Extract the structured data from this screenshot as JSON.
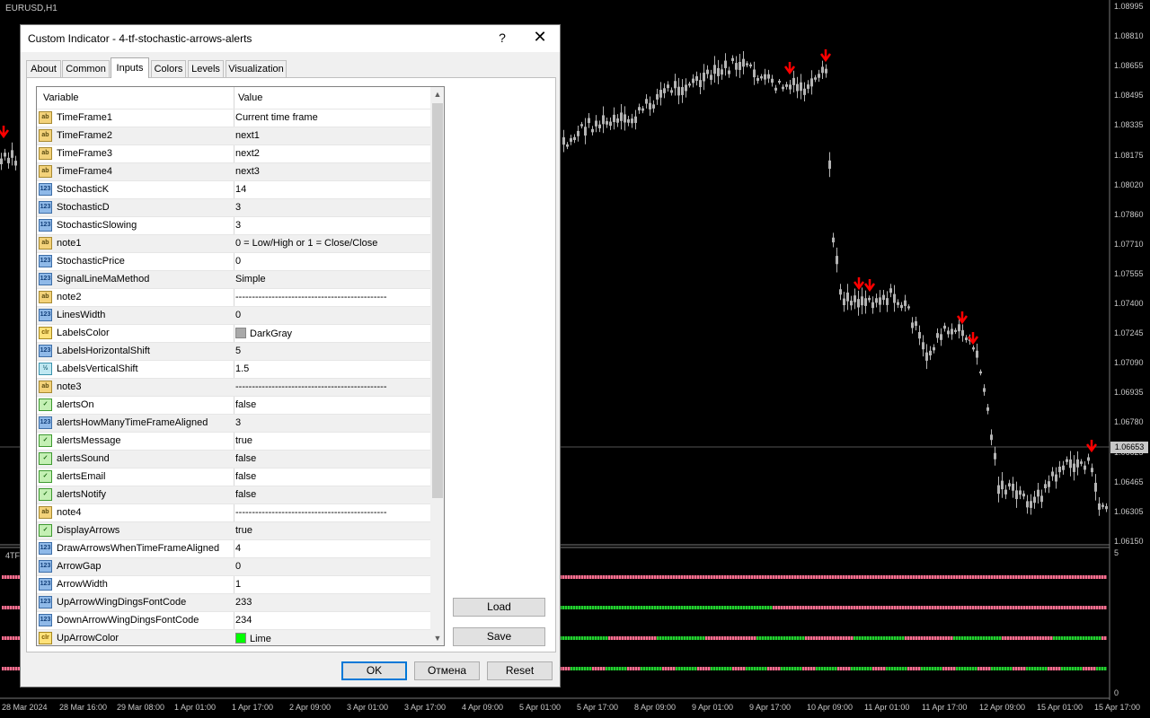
{
  "chart": {
    "symbol_label": "EURUSD,H1",
    "current_price": "1.06653",
    "price_axis": [
      "1.08995",
      "1.08810",
      "1.08655",
      "1.08495",
      "1.08335",
      "1.08175",
      "1.08020",
      "1.07860",
      "1.07710",
      "1.07555",
      "1.07400",
      "1.07245",
      "1.07090",
      "1.06935",
      "1.06780",
      "1.06625",
      "1.06465",
      "1.06305",
      "1.06150"
    ],
    "time_axis": [
      "28 Mar 2024",
      "28 Mar 16:00",
      "29 Mar 08:00",
      "1 Apr 01:00",
      "1 Apr 17:00",
      "2 Apr 09:00",
      "3 Apr 01:00",
      "3 Apr 17:00",
      "4 Apr 09:00",
      "5 Apr 01:00",
      "5 Apr 17:00",
      "8 Apr 09:00",
      "9 Apr 01:00",
      "9 Apr 17:00",
      "10 Apr 09:00",
      "11 Apr 01:00",
      "11 Apr 17:00",
      "12 Apr 09:00",
      "15 Apr 01:00",
      "15 Apr 17:00"
    ],
    "subwindow_label": "4TF",
    "subwindow_axis_top": "5",
    "subwindow_axis_bottom": "0",
    "colors": {
      "bull_bar": "#ff6f91",
      "bear_bar": "#22d22f",
      "arrow": "#ff0000",
      "candle": "#b4b4b4"
    }
  },
  "dialog": {
    "title": "Custom Indicator - 4-tf-stochastic-arrows-alerts",
    "help_label": "?",
    "close_label": "✕",
    "tabs": [
      {
        "label": "About"
      },
      {
        "label": "Common"
      },
      {
        "label": "Inputs"
      },
      {
        "label": "Colors"
      },
      {
        "label": "Levels"
      },
      {
        "label": "Visualization"
      }
    ],
    "active_tab": "Inputs",
    "grid": {
      "header_variable": "Variable",
      "header_value": "Value",
      "rows": [
        {
          "type": "ab",
          "icon": "ab",
          "name": "TimeFrame1",
          "value": "Current time frame"
        },
        {
          "type": "ab",
          "icon": "ab",
          "name": "TimeFrame2",
          "value": "next1"
        },
        {
          "type": "ab",
          "icon": "ab",
          "name": "TimeFrame3",
          "value": "next2"
        },
        {
          "type": "ab",
          "icon": "ab",
          "name": "TimeFrame4",
          "value": "next3"
        },
        {
          "type": "num",
          "icon": "123",
          "name": "StochasticK",
          "value": "14"
        },
        {
          "type": "num",
          "icon": "123",
          "name": "StochasticD",
          "value": "3"
        },
        {
          "type": "num",
          "icon": "123",
          "name": "StochasticSlowing",
          "value": "3"
        },
        {
          "type": "ab",
          "icon": "ab",
          "name": "note1",
          "value": "0 = Low/High or 1 = Close/Close"
        },
        {
          "type": "num",
          "icon": "123",
          "name": "StochasticPrice",
          "value": "0"
        },
        {
          "type": "num",
          "icon": "123",
          "name": "SignalLineMaMethod",
          "value": "Simple"
        },
        {
          "type": "ab",
          "icon": "ab",
          "name": "note2",
          "value": "----------------------------------------------"
        },
        {
          "type": "num",
          "icon": "123",
          "name": "LinesWidth",
          "value": "0"
        },
        {
          "type": "color",
          "icon": "clr",
          "name": "LabelsColor",
          "value": "DarkGray",
          "swatch": "#a9a9a9"
        },
        {
          "type": "num",
          "icon": "123",
          "name": "LabelsHorizontalShift",
          "value": "5"
        },
        {
          "type": "dbl",
          "icon": "½",
          "name": "LabelsVerticalShift",
          "value": "1.5"
        },
        {
          "type": "ab",
          "icon": "ab",
          "name": "note3",
          "value": "----------------------------------------------"
        },
        {
          "type": "bool",
          "icon": "✓",
          "name": "alertsOn",
          "value": "false"
        },
        {
          "type": "num",
          "icon": "123",
          "name": "alertsHowManyTimeFrameAligned",
          "value": "3"
        },
        {
          "type": "bool",
          "icon": "✓",
          "name": "alertsMessage",
          "value": "true"
        },
        {
          "type": "bool",
          "icon": "✓",
          "name": "alertsSound",
          "value": "false"
        },
        {
          "type": "bool",
          "icon": "✓",
          "name": "alertsEmail",
          "value": "false"
        },
        {
          "type": "bool",
          "icon": "✓",
          "name": "alertsNotify",
          "value": "false"
        },
        {
          "type": "ab",
          "icon": "ab",
          "name": "note4",
          "value": "----------------------------------------------"
        },
        {
          "type": "bool",
          "icon": "✓",
          "name": "DisplayArrows",
          "value": "true"
        },
        {
          "type": "num",
          "icon": "123",
          "name": "DrawArrowsWhenTimeFrameAligned",
          "value": "4"
        },
        {
          "type": "num",
          "icon": "123",
          "name": "ArrowGap",
          "value": "0"
        },
        {
          "type": "num",
          "icon": "123",
          "name": "ArrowWidth",
          "value": "1"
        },
        {
          "type": "num",
          "icon": "123",
          "name": "UpArrowWingDingsFontCode",
          "value": "233"
        },
        {
          "type": "num",
          "icon": "123",
          "name": "DownArrowWingDingsFontCode",
          "value": "234"
        },
        {
          "type": "color",
          "icon": "clr",
          "name": "UpArrowColor",
          "value": "Lime",
          "swatch": "#00ff00"
        }
      ]
    },
    "load_label": "Load",
    "save_label": "Save",
    "ok_label": "OK",
    "cancel_label": "Отмена",
    "reset_label": "Reset"
  }
}
